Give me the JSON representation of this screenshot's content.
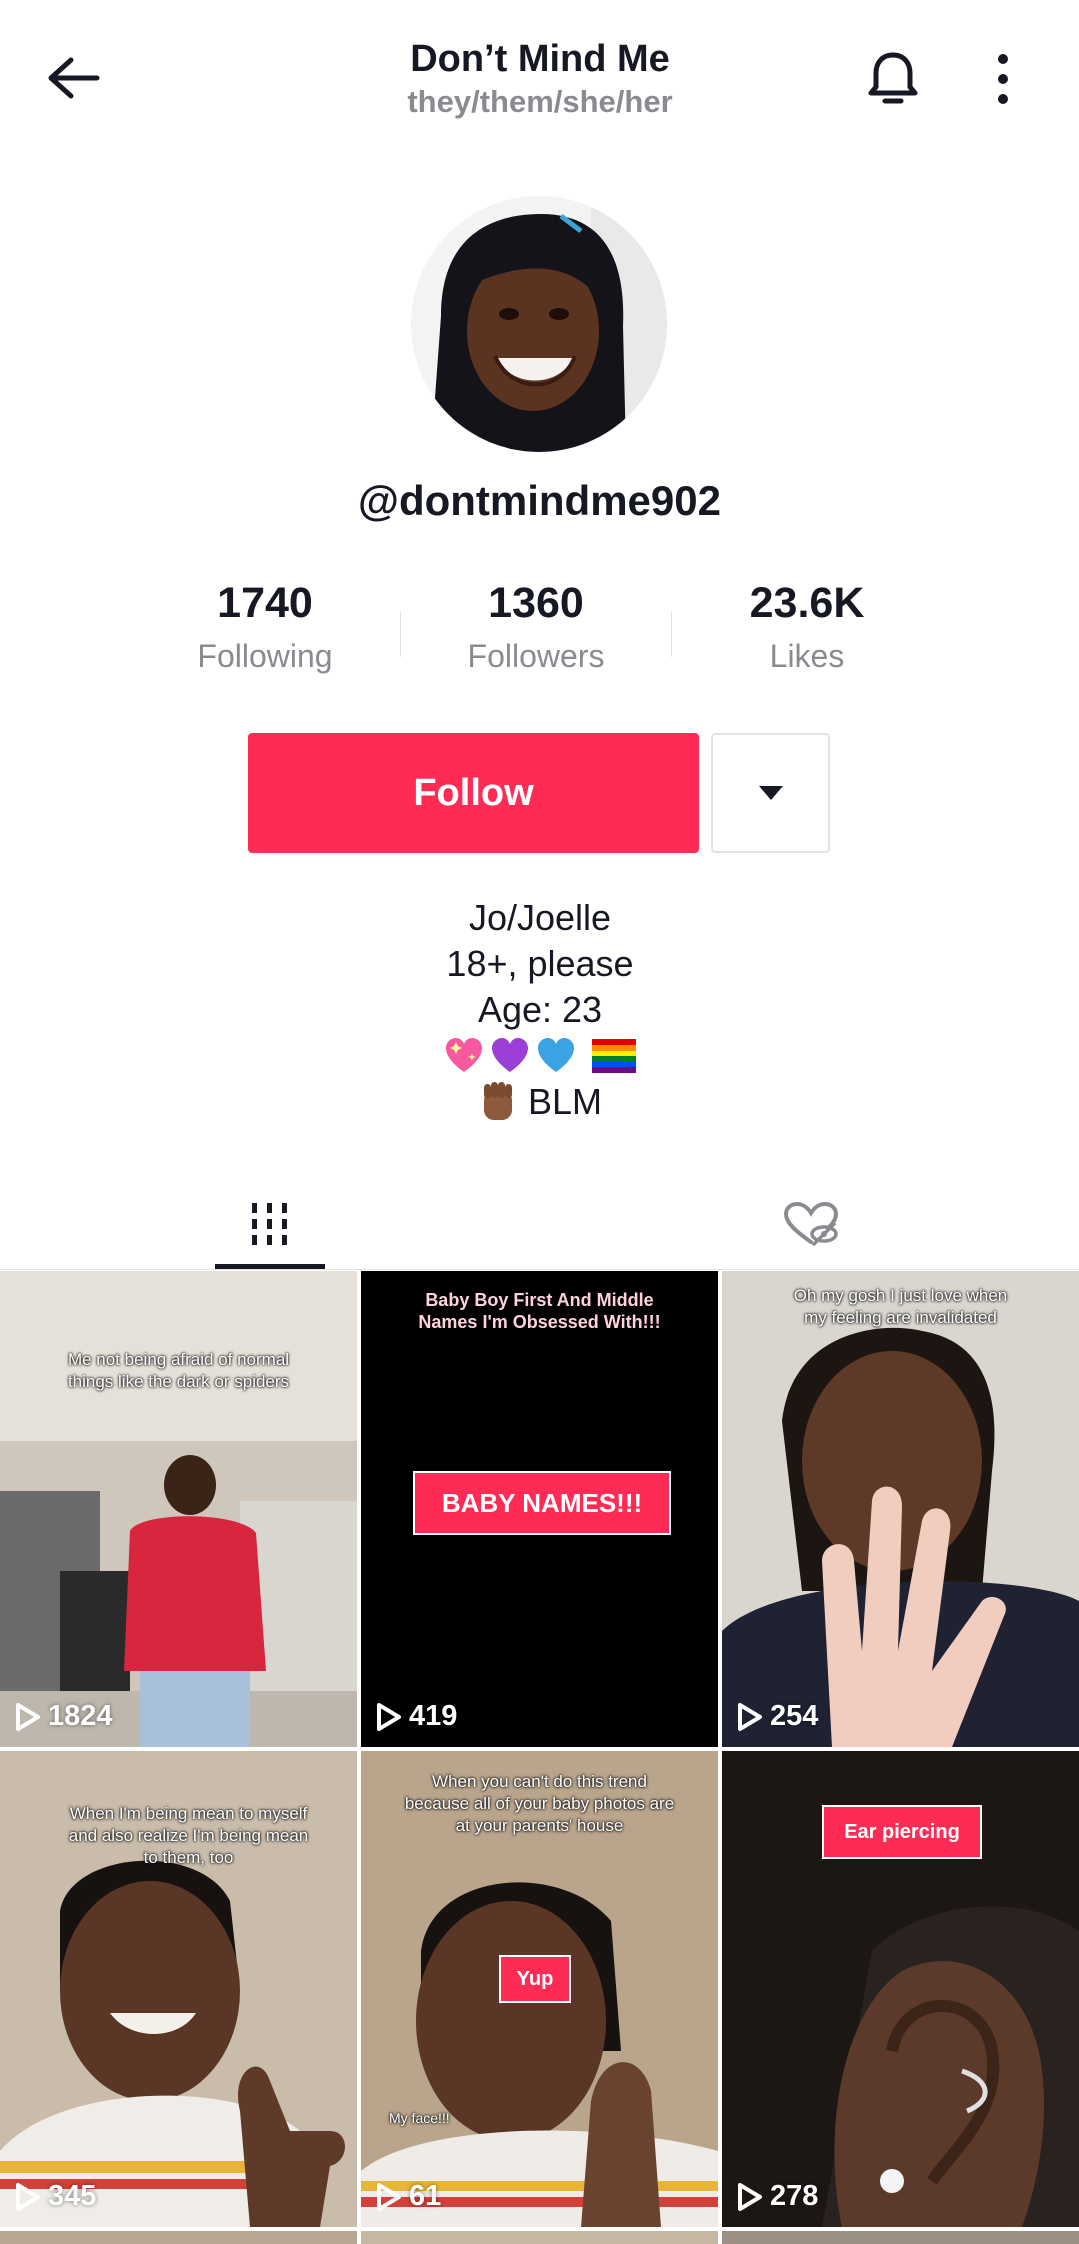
{
  "header": {
    "title": "Don’t Mind Me",
    "subtitle": "they/them/she/her"
  },
  "profile": {
    "username": "@dontmindme902"
  },
  "stats": [
    {
      "value": "1740",
      "label": "Following"
    },
    {
      "value": "1360",
      "label": "Followers"
    },
    {
      "value": "23.6K",
      "label": "Likes"
    }
  ],
  "actions": {
    "follow_label": "Follow"
  },
  "bio": {
    "line1": "Jo/Joelle",
    "line2": "18+, please",
    "line3": "Age: 23",
    "line5_text": "BLM"
  },
  "colors": {
    "accent": "#fe2c55",
    "text_primary": "#161823",
    "text_secondary": "#8a8b91"
  },
  "videos": [
    {
      "caption": "Me not being afraid of normal things like the dark or spiders",
      "plays": "1824"
    },
    {
      "caption": "Baby Boy First And Middle Names I'm Obsessed With!!!",
      "tag": "BABY NAMES!!!",
      "plays": "419"
    },
    {
      "caption": "Oh my gosh I just love when my feeling are invalidated",
      "plays": "254"
    },
    {
      "caption": "When I'm being mean to myself and also realize I'm being mean to them, too",
      "plays": "345"
    },
    {
      "caption": "When you can't do this trend because all of your baby photos are at your parents' house",
      "tag": "Yup",
      "sub": "My face!!!",
      "plays": "61"
    },
    {
      "tag": "Ear piercing",
      "plays": "278"
    }
  ]
}
